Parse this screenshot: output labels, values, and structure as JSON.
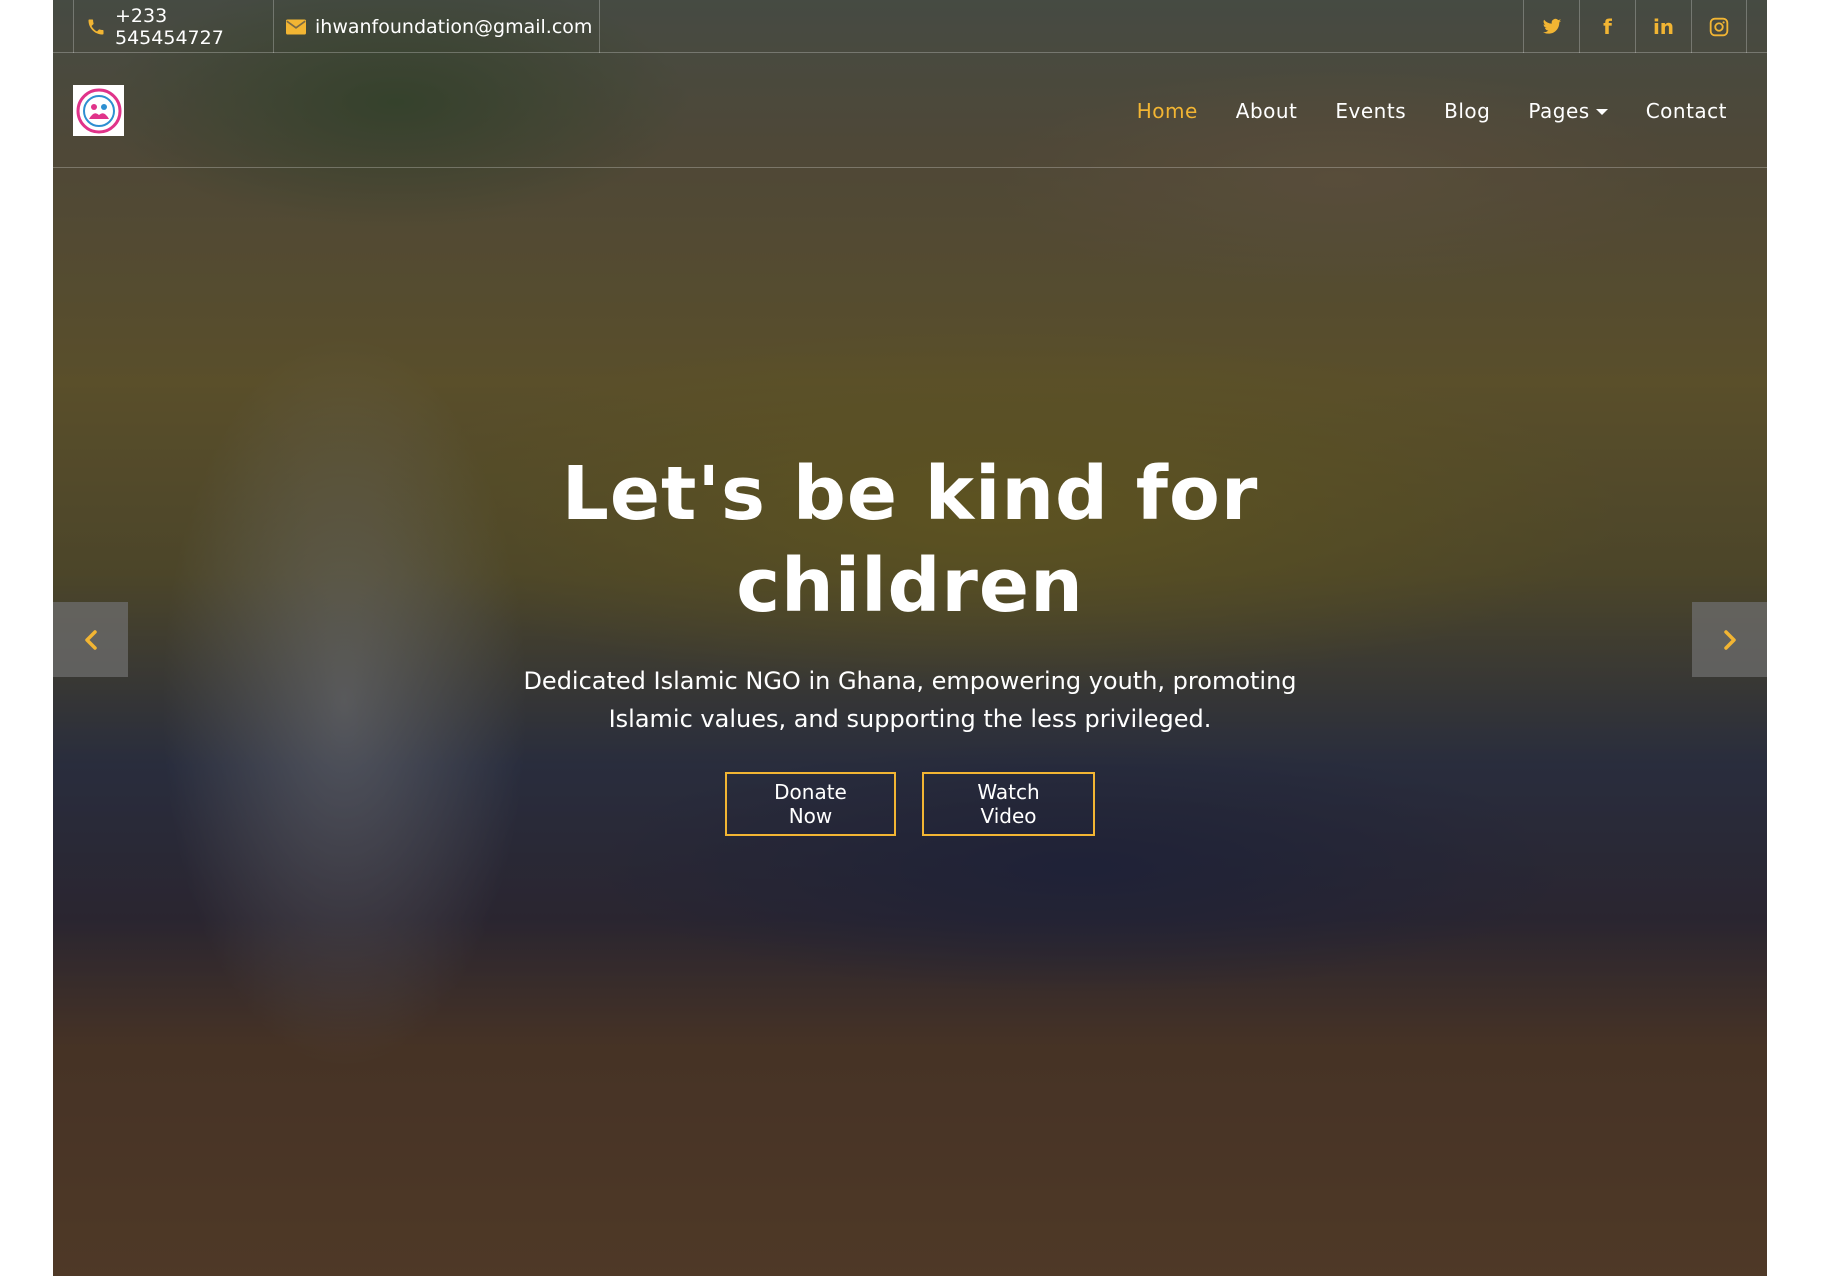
{
  "topbar": {
    "phone": "+233 545454727",
    "email": "ihwanfoundation@gmail.com",
    "socials": [
      {
        "name": "twitter-icon",
        "glyph": "🐦"
      },
      {
        "name": "facebook-icon",
        "glyph": "f"
      },
      {
        "name": "linkedin-icon",
        "glyph": "in"
      },
      {
        "name": "instagram-icon",
        "glyph": "◎"
      }
    ]
  },
  "nav": {
    "items": [
      {
        "label": "Home",
        "active": true
      },
      {
        "label": "About",
        "active": false
      },
      {
        "label": "Events",
        "active": false
      },
      {
        "label": "Blog",
        "active": false
      },
      {
        "label": "Pages",
        "active": false,
        "dropdown": true
      },
      {
        "label": "Contact",
        "active": false
      }
    ]
  },
  "hero": {
    "title": "Let's be kind for children",
    "subtitle": "Dedicated Islamic NGO in Ghana, empowering youth, promoting Islamic values, and supporting the less privileged.",
    "buttons": {
      "donate": "Donate Now",
      "video": "Watch Video"
    }
  },
  "colors": {
    "accent": "#f2b533",
    "text": "#ffffff",
    "arrow_bg": "#6e6e6e"
  },
  "icons": {
    "phone": "phone-icon",
    "email": "envelope-icon",
    "prev": "chevron-left-icon",
    "next": "chevron-right-icon",
    "logo": "foundation-logo"
  }
}
